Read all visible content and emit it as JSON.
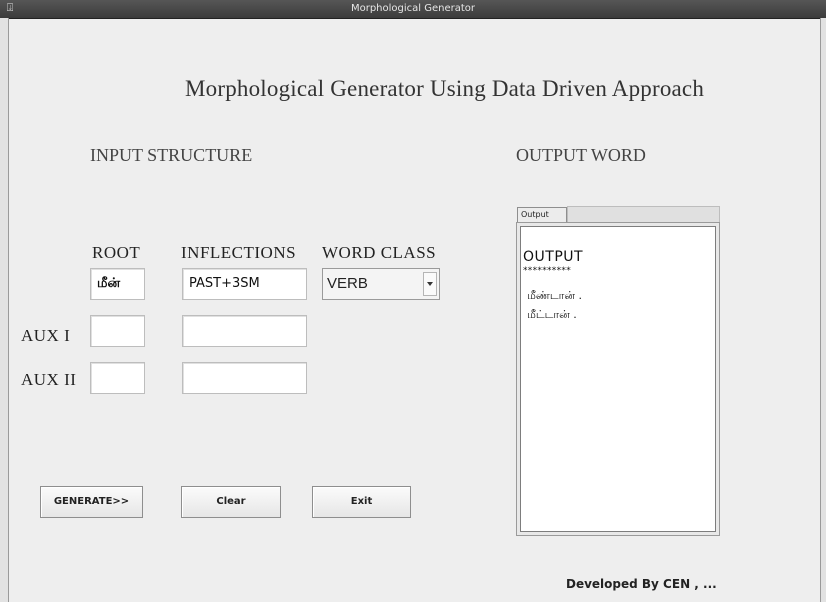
{
  "window": {
    "title": "Morphological Generator"
  },
  "heading": "Morphological Generator Using Data Driven Approach",
  "input_section": {
    "title": "INPUT  STRUCTURE"
  },
  "output_section": {
    "title": "OUTPUT  WORD"
  },
  "columns": {
    "root": "ROOT",
    "inflections": "INFLECTIONS",
    "word_class": "WORD  CLASS"
  },
  "rows": {
    "root_row": {
      "root_value": "மீன்",
      "inflection_value": "PAST+3SM"
    },
    "aux1": {
      "label": "AUX I",
      "root_value": "",
      "inflection_value": ""
    },
    "aux2": {
      "label": "AUX II",
      "root_value": "",
      "inflection_value": ""
    }
  },
  "word_class": {
    "selected": "VERB"
  },
  "buttons": {
    "generate": "GENERATE>>",
    "clear": "Clear",
    "exit": "Exit"
  },
  "output_panel": {
    "tab_label": "Output",
    "title": "OUTPUT",
    "stars": "**********",
    "lines": [
      "மீண்டான் .",
      "மீட்டான் ."
    ]
  },
  "footer": "Developed By CEN , ..."
}
